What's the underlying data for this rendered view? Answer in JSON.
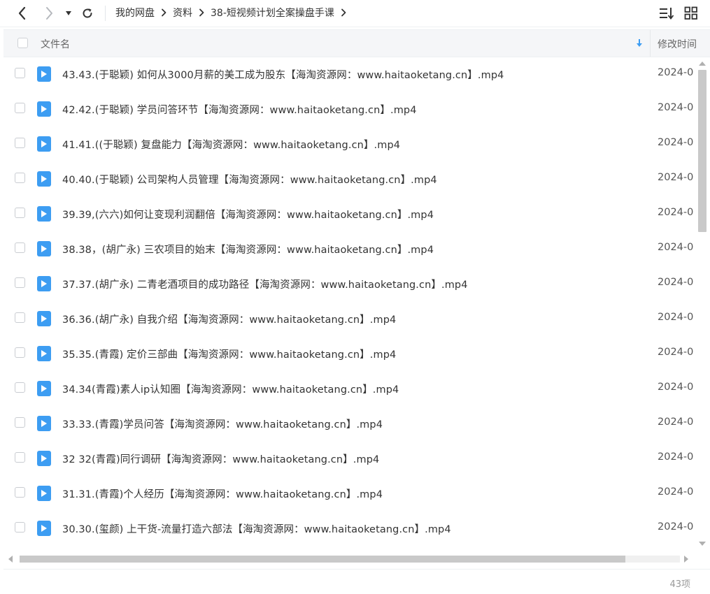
{
  "breadcrumb": [
    "我的网盘",
    "资料",
    "38-短视频计划全案操盘手课"
  ],
  "header": {
    "name_label": "文件名",
    "time_label": "修改时间"
  },
  "files": [
    {
      "name": "43.43.(于聪颖) 如何从3000月薪的美工成为股东【海淘资源网：www.haitaoketang.cn】.mp4",
      "time": "2024-0"
    },
    {
      "name": "42.42.(于聪颖) 学员问答环节【海淘资源网：www.haitaoketang.cn】.mp4",
      "time": "2024-0"
    },
    {
      "name": "41.41.((于聪颖) 复盘能力【海淘资源网：www.haitaoketang.cn】.mp4",
      "time": "2024-0"
    },
    {
      "name": "40.40.(于聪颖) 公司架构人员管理【海淘资源网：www.haitaoketang.cn】.mp4",
      "time": "2024-0"
    },
    {
      "name": "39.39,(六六)如何让变现利润翻倍【海淘资源网：www.haitaoketang.cn】.mp4",
      "time": "2024-0"
    },
    {
      "name": "38.38，(胡广永) 三农项目的始末【海淘资源网：www.haitaoketang.cn】.mp4",
      "time": "2024-0"
    },
    {
      "name": "37.37.(胡广永) 二青老酒项目的成功路径【海淘资源网：www.haitaoketang.cn】.mp4",
      "time": "2024-0"
    },
    {
      "name": "36.36.(胡广永) 自我介绍【海淘资源网：www.haitaoketang.cn】.mp4",
      "time": "2024-0"
    },
    {
      "name": "35.35.(青霞) 定价三部曲【海淘资源网：www.haitaoketang.cn】.mp4",
      "time": "2024-0"
    },
    {
      "name": "34.34(青霞)素人ip认知圈【海淘资源网：www.haitaoketang.cn】.mp4",
      "time": "2024-0"
    },
    {
      "name": "33.33.(青霞)学员问答【海淘资源网：www.haitaoketang.cn】.mp4",
      "time": "2024-0"
    },
    {
      "name": "32 32(青霞)同行调研【海淘资源网：www.haitaoketang.cn】.mp4",
      "time": "2024-0"
    },
    {
      "name": "31.31.(青霞)个人经历【海淘资源网：www.haitaoketang.cn】.mp4",
      "time": "2024-0"
    },
    {
      "name": "30.30.(玺颜) 上干货-流量打造六部法【海淘资源网：www.haitaoketang.cn】.mp4",
      "time": "2024-0"
    }
  ],
  "footer": {
    "count": "43项"
  },
  "colors": {
    "accent": "#3d9df2",
    "text": "#333333",
    "muted": "#999999"
  },
  "icons": {
    "back": "chevron-left-icon",
    "forward": "chevron-right-icon",
    "dropdown": "caret-down-icon",
    "refresh": "refresh-icon",
    "sort": "sort-list-icon",
    "grid": "grid-view-icon",
    "file": "video-file-icon",
    "sort_arrow": "arrow-down-icon"
  }
}
